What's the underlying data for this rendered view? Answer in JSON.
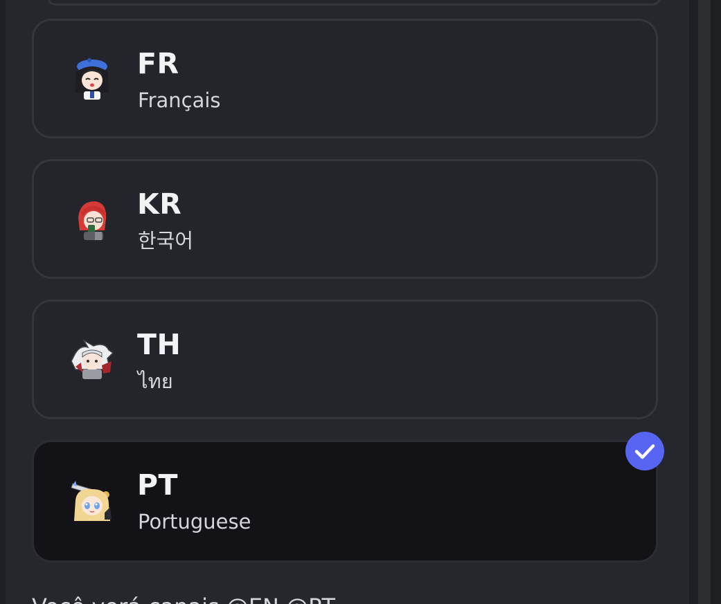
{
  "languages": [
    {
      "code": "FR",
      "name": "Français",
      "avatar_icon": "anime-girl-blue-beret-icon",
      "selected": false
    },
    {
      "code": "KR",
      "name": "한국어",
      "avatar_icon": "anime-redhead-icon",
      "selected": false
    },
    {
      "code": "TH",
      "name": "ไทย",
      "avatar_icon": "anime-white-hair-icon",
      "selected": false
    },
    {
      "code": "PT",
      "name": "Portuguese",
      "avatar_icon": "anime-blonde-sword-icon",
      "selected": true
    }
  ],
  "selected_badge_icon": "checkmark-icon",
  "footer": {
    "text": "Você verá canais @EN @PT"
  },
  "colors": {
    "background": "#26272d",
    "card": "#24252b",
    "card_selected": "#121217",
    "accent": "#5865f2",
    "text_primary": "#f2f3f5",
    "text_secondary": "#d4d6db"
  }
}
